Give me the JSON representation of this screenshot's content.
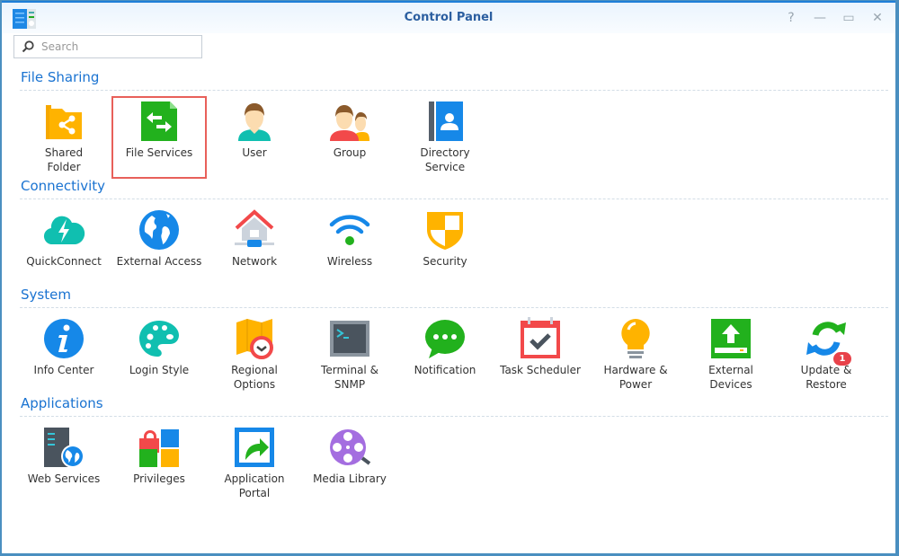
{
  "window": {
    "title": "Control Panel"
  },
  "controls": {
    "help": "?",
    "minimize": "—",
    "maximize": "▭",
    "close": "✕"
  },
  "search": {
    "placeholder": "Search",
    "value": ""
  },
  "sections": [
    {
      "title": "File Sharing",
      "items": [
        {
          "label": "Shared\nFolder",
          "icon": "shared-folder-icon"
        },
        {
          "label": "File Services",
          "icon": "file-services-icon",
          "selected": true
        },
        {
          "label": "User",
          "icon": "user-icon"
        },
        {
          "label": "Group",
          "icon": "group-icon"
        },
        {
          "label": "Directory\nService",
          "icon": "directory-service-icon"
        }
      ]
    },
    {
      "title": "Connectivity",
      "items": [
        {
          "label": "QuickConnect",
          "icon": "quickconnect-icon"
        },
        {
          "label": "External Access",
          "icon": "external-access-icon"
        },
        {
          "label": "Network",
          "icon": "network-icon"
        },
        {
          "label": "Wireless",
          "icon": "wireless-icon"
        },
        {
          "label": "Security",
          "icon": "security-icon"
        }
      ]
    },
    {
      "title": "System",
      "items": [
        {
          "label": "Info Center",
          "icon": "info-center-icon"
        },
        {
          "label": "Login Style",
          "icon": "login-style-icon"
        },
        {
          "label": "Regional\nOptions",
          "icon": "regional-options-icon"
        },
        {
          "label": "Terminal &\nSNMP",
          "icon": "terminal-icon"
        },
        {
          "label": "Notification",
          "icon": "notification-icon"
        },
        {
          "label": "Task Scheduler",
          "icon": "task-scheduler-icon"
        },
        {
          "label": "Hardware &\nPower",
          "icon": "hardware-power-icon"
        },
        {
          "label": "External\nDevices",
          "icon": "external-devices-icon"
        },
        {
          "label": "Update &\nRestore",
          "icon": "update-restore-icon",
          "badge": "1"
        }
      ]
    },
    {
      "title": "Applications",
      "items": [
        {
          "label": "Web Services",
          "icon": "web-services-icon"
        },
        {
          "label": "Privileges",
          "icon": "privileges-icon"
        },
        {
          "label": "Application\nPortal",
          "icon": "application-portal-icon"
        },
        {
          "label": "Media Library",
          "icon": "media-library-icon"
        }
      ]
    }
  ]
}
